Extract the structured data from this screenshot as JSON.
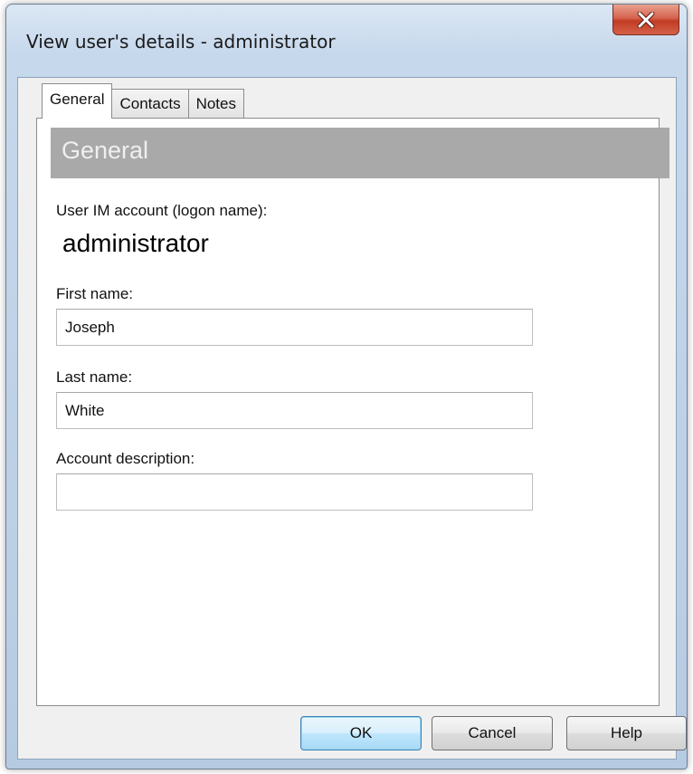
{
  "window": {
    "title": "View user's details - administrator",
    "close_icon": "close-icon"
  },
  "tabs": [
    {
      "label": "General",
      "active": true
    },
    {
      "label": "Contacts",
      "active": false
    },
    {
      "label": "Notes",
      "active": false
    }
  ],
  "general": {
    "section_title": "General",
    "account_label": "User IM account (logon name):",
    "account_value": "administrator",
    "first_name_label": "First name:",
    "first_name_value": "Joseph",
    "last_name_label": "Last name:",
    "last_name_value": "White",
    "description_label": "Account description:",
    "description_value": ""
  },
  "buttons": {
    "ok": "OK",
    "cancel": "Cancel",
    "help": "Help"
  },
  "colors": {
    "section_header_bg": "#a9a9a9",
    "close_button": "#c9452d",
    "default_button_border": "#3c7fb1"
  }
}
